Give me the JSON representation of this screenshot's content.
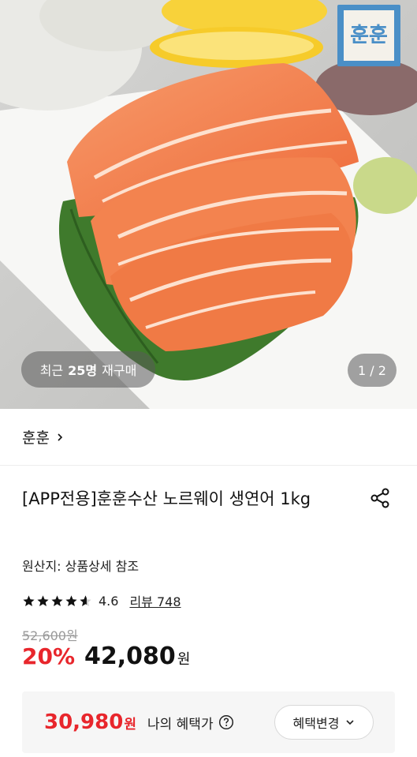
{
  "gallery": {
    "brand_logo_text": "훈훈",
    "rebuy_prefix": "최근",
    "rebuy_count": "25명",
    "rebuy_suffix": "재구매",
    "page_counter": "1 / 2"
  },
  "store": {
    "name": "훈훈"
  },
  "product": {
    "title": "[APP전용]훈훈수산 노르웨이 생연어 1kg",
    "origin": "원산지: 상품상세 참조",
    "rating": "4.6",
    "stars_value": 4.6,
    "review_label": "리뷰 748",
    "original_price": "52,600원",
    "discount": "20%",
    "sale_price": "42,080",
    "currency": "원"
  },
  "benefit": {
    "price": "30,980",
    "currency": "원",
    "label": "나의 혜택가",
    "change_button": "혜택변경"
  },
  "colors": {
    "accent_red": "#e8262c",
    "logo_blue": "#4a8fc7"
  },
  "icons": {
    "share": "share-icon",
    "help": "question-circle-icon",
    "chevron_right": "chevron-right-icon",
    "chevron_down": "chevron-down-icon",
    "star": "star-icon"
  }
}
